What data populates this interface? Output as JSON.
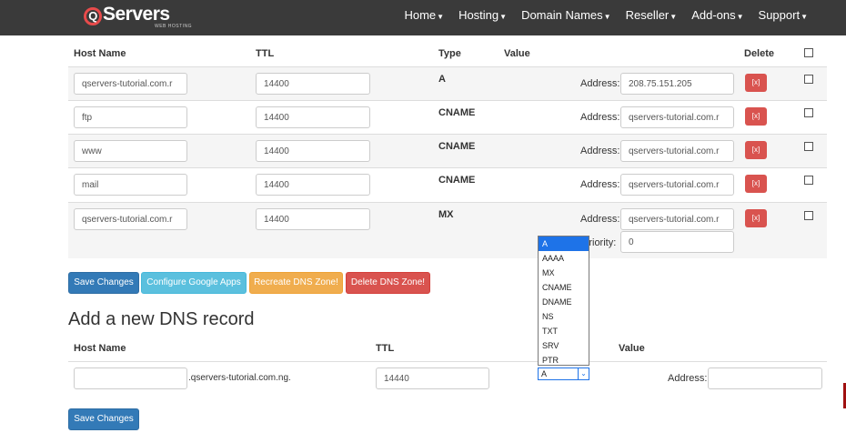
{
  "brand": {
    "logo_text": "Servers",
    "logo_letter": "Q",
    "logo_sub": "WEB HOSTING"
  },
  "nav": [
    {
      "label": "Home"
    },
    {
      "label": "Hosting"
    },
    {
      "label": "Domain Names"
    },
    {
      "label": "Reseller"
    },
    {
      "label": "Add-ons"
    },
    {
      "label": "Support"
    }
  ],
  "records_table": {
    "headers": {
      "host": "Host Name",
      "ttl": "TTL",
      "type": "Type",
      "value": "Value",
      "delete": "Delete"
    },
    "address_label": "Address:",
    "priority_label": "Priority:",
    "delete_label": "[x]",
    "rows": [
      {
        "host": "qservers-tutorial.com.r",
        "ttl": "14400",
        "type": "A",
        "address": "208.75.151.205"
      },
      {
        "host": "ftp",
        "ttl": "14400",
        "type": "CNAME",
        "address": "qservers-tutorial.com.r"
      },
      {
        "host": "www",
        "ttl": "14400",
        "type": "CNAME",
        "address": "qservers-tutorial.com.r"
      },
      {
        "host": "mail",
        "ttl": "14400",
        "type": "CNAME",
        "address": "qservers-tutorial.com.r"
      },
      {
        "host": "qservers-tutorial.com.r",
        "ttl": "14400",
        "type": "MX",
        "address": "qservers-tutorial.com.r",
        "priority": "0"
      }
    ]
  },
  "actions": {
    "save": "Save Changes",
    "google_apps": "Configure Google Apps",
    "recreate": "Recreate DNS Zone!",
    "delete_zone": "Delete DNS Zone!"
  },
  "new_record": {
    "title": "Add a new DNS record",
    "headers": {
      "host": "Host Name",
      "ttl": "TTL",
      "value": "Value"
    },
    "host_value": "",
    "domain_suffix": ".qservers-tutorial.com.ng.",
    "ttl_value": "14440",
    "type_selected": "A",
    "address_label": "Address:",
    "address_value": "",
    "save": "Save Changes"
  },
  "type_options": [
    "A",
    "AAAA",
    "MX",
    "CNAME",
    "DNAME",
    "NS",
    "TXT",
    "SRV",
    "PTR"
  ],
  "colors": {
    "primary": "#337ab7",
    "info": "#5bc0de",
    "warning": "#f0ad4e",
    "danger": "#d9534f",
    "header": "#3a3a3a",
    "select_highlight": "#1e73e8"
  }
}
